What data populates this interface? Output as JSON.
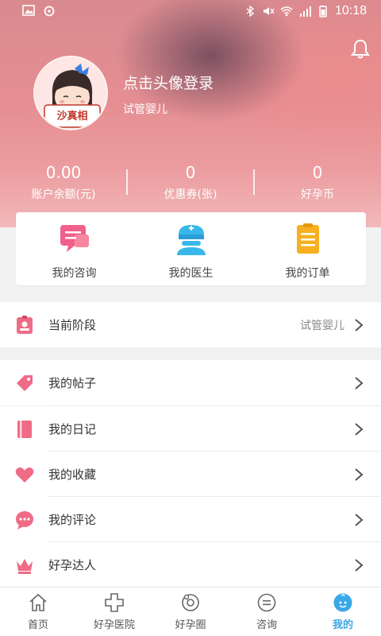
{
  "status_bar": {
    "time": "10:18"
  },
  "profile": {
    "login_prompt": "点击头像登录",
    "stage": "试管婴儿",
    "avatar_caption": "沙真相"
  },
  "stats": [
    {
      "value": "0.00",
      "label": "账户余额(元)"
    },
    {
      "value": "0",
      "label": "优惠券(张)"
    },
    {
      "value": "0",
      "label": "好孕币"
    }
  ],
  "quick_actions": [
    {
      "label": "我的咨询",
      "icon": "consult-icon"
    },
    {
      "label": "我的医生",
      "icon": "doctor-icon"
    },
    {
      "label": "我的订单",
      "icon": "order-icon"
    }
  ],
  "current_stage": {
    "label": "当前阶段",
    "value": "试管婴儿",
    "icon": "id-card-icon"
  },
  "menu": [
    {
      "label": "我的帖子",
      "icon": "tag-icon"
    },
    {
      "label": "我的日记",
      "icon": "diary-icon"
    },
    {
      "label": "我的收藏",
      "icon": "heart-icon"
    },
    {
      "label": "我的评论",
      "icon": "comment-icon"
    },
    {
      "label": "好孕达人",
      "icon": "crown-icon"
    }
  ],
  "nav": [
    {
      "label": "首页",
      "icon": "home-icon"
    },
    {
      "label": "好孕医院",
      "icon": "hospital-icon"
    },
    {
      "label": "好孕圈",
      "icon": "circle-icon"
    },
    {
      "label": "咨询",
      "icon": "chat-icon"
    },
    {
      "label": "我的",
      "icon": "profile-icon",
      "active": true
    }
  ],
  "colors": {
    "accent": "#3aa7e8",
    "header": "#e58e92",
    "pink_icon": "#ef6b86"
  }
}
